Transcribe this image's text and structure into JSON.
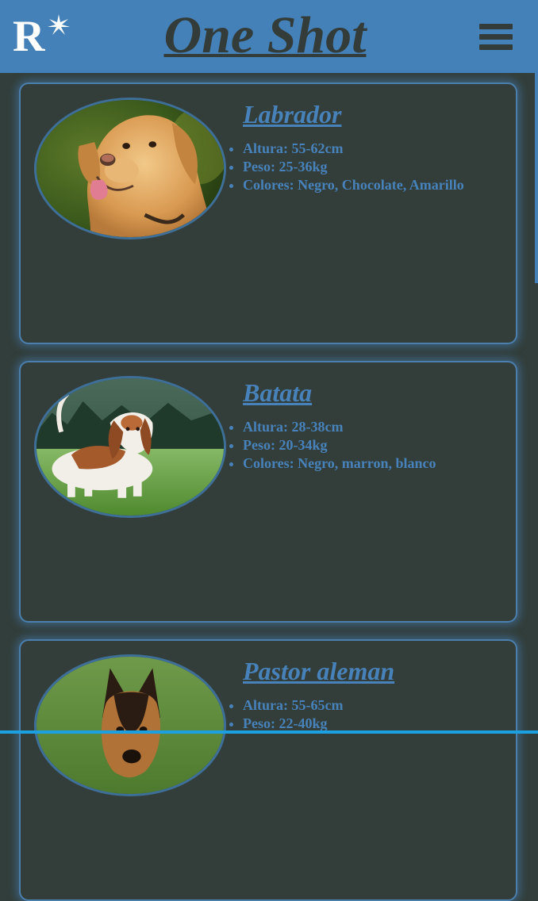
{
  "header": {
    "logo_letter": "R",
    "title": "One Shot",
    "menu_icon": "hamburger-menu-icon"
  },
  "colors": {
    "header_bg": "#4581b9",
    "page_bg": "#323e3b",
    "accent_text": "#4782bb",
    "title_text": "#333c38"
  },
  "breeds": [
    {
      "name": "Labrador",
      "photo": "labrador-photo",
      "specs": [
        "Altura: 55-62cm",
        "Peso: 25-36kg",
        "Colores: Negro, Chocolate, Amarillo"
      ]
    },
    {
      "name": "Batata",
      "photo": "basset-hound-photo",
      "specs": [
        "Altura: 28-38cm",
        "Peso: 20-34kg",
        "Colores: Negro, marron, blanco"
      ]
    },
    {
      "name": "Pastor aleman",
      "photo": "german-shepherd-photo",
      "specs": [
        "Altura: 55-65cm",
        "Peso: 22-40kg"
      ]
    }
  ]
}
